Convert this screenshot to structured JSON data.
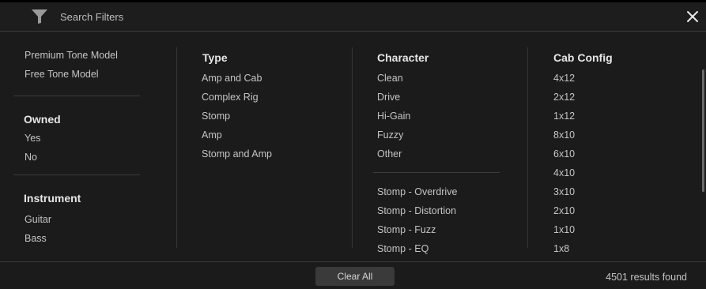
{
  "header": {
    "title": "Search Filters",
    "filter_icon": "funnel-icon",
    "close_icon": "close-icon"
  },
  "column1": {
    "tone_models": [
      "Premium Tone Model",
      "Free Tone Model"
    ],
    "owned": {
      "heading": "Owned",
      "items": [
        "Yes",
        "No"
      ]
    },
    "instrument": {
      "heading": "Instrument",
      "items": [
        "Guitar",
        "Bass"
      ]
    }
  },
  "column2": {
    "heading": "Type",
    "items": [
      "Amp and Cab",
      "Complex Rig",
      "Stomp",
      "Amp",
      "Stomp and Amp"
    ]
  },
  "column3": {
    "heading": "Character",
    "items": [
      "Clean",
      "Drive",
      "Hi-Gain",
      "Fuzzy",
      "Other"
    ],
    "stomp_items": [
      "Stomp - Overdrive",
      "Stomp - Distortion",
      "Stomp - Fuzz",
      "Stomp - EQ"
    ]
  },
  "column4": {
    "heading": "Cab Config",
    "items": [
      "4x12",
      "2x12",
      "1x12",
      "8x10",
      "6x10",
      "4x10",
      "3x10",
      "2x10",
      "1x10",
      "1x8"
    ]
  },
  "footer": {
    "clear_label": "Clear All",
    "results_text": "4501 results found"
  },
  "colors": {
    "background": "#1b1b1b",
    "heading": "#e6e6e6",
    "text": "#c4c4c4",
    "button": "#3a3a3a"
  }
}
